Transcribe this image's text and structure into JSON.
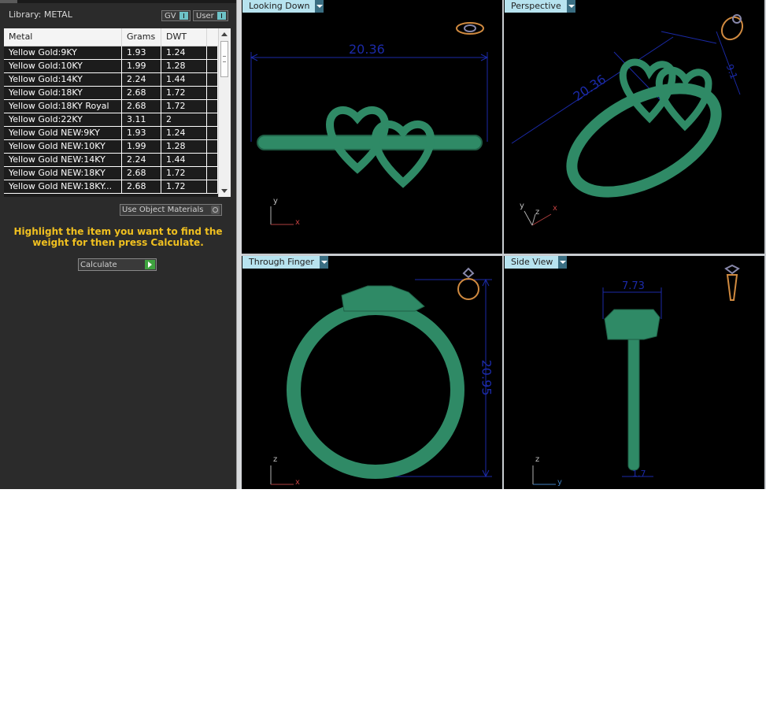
{
  "library": {
    "title": "Library: METAL",
    "gv_label": "GV",
    "user_label": "User"
  },
  "table": {
    "headers": [
      "Metal",
      "Grams",
      "DWT"
    ],
    "rows": [
      [
        "Yellow Gold:9KY",
        "1.93",
        "1.24"
      ],
      [
        "Yellow Gold:10KY",
        "1.99",
        "1.28"
      ],
      [
        "Yellow Gold:14KY",
        "2.24",
        "1.44"
      ],
      [
        "Yellow Gold:18KY",
        "2.68",
        "1.72"
      ],
      [
        "Yellow Gold:18KY Royal",
        "2.68",
        "1.72"
      ],
      [
        "Yellow Gold:22KY",
        "3.11",
        "2"
      ],
      [
        "Yellow Gold NEW:9KY",
        "1.93",
        "1.24"
      ],
      [
        "Yellow Gold NEW:10KY",
        "1.99",
        "1.28"
      ],
      [
        "Yellow Gold NEW:14KY",
        "2.24",
        "1.44"
      ],
      [
        "Yellow Gold NEW:18KY",
        "2.68",
        "1.72"
      ],
      [
        "Yellow Gold NEW:18KY...",
        "2.68",
        "1.72"
      ]
    ]
  },
  "use_object_materials": "Use Object Materials",
  "hint": "Highlight the item you want to find the weight for then press Calculate.",
  "calculate_label": "Calculate",
  "viewports": {
    "looking_down": {
      "label": "Looking Down",
      "dimension": "20.36",
      "axis1": "y",
      "axis2": "x"
    },
    "perspective": {
      "label": "Perspective",
      "dimension_a": "20.36",
      "dimension_b": "9.1",
      "axis1": "y",
      "axis2": "z",
      "axis3": "x"
    },
    "through_finger": {
      "label": "Through Finger",
      "dimension": "20.95",
      "axis1": "z",
      "axis2": "x"
    },
    "side_view": {
      "label": "Side View",
      "dimension_top": "7.73",
      "dimension_bottom": "1.7",
      "axis1": "z",
      "axis2": "y"
    }
  },
  "colors": {
    "ring_green": "#2f8a66",
    "dimension_blue": "#1b2aa8",
    "label_bg": "#b7e3ef",
    "hint_yellow": "#f0c020"
  }
}
